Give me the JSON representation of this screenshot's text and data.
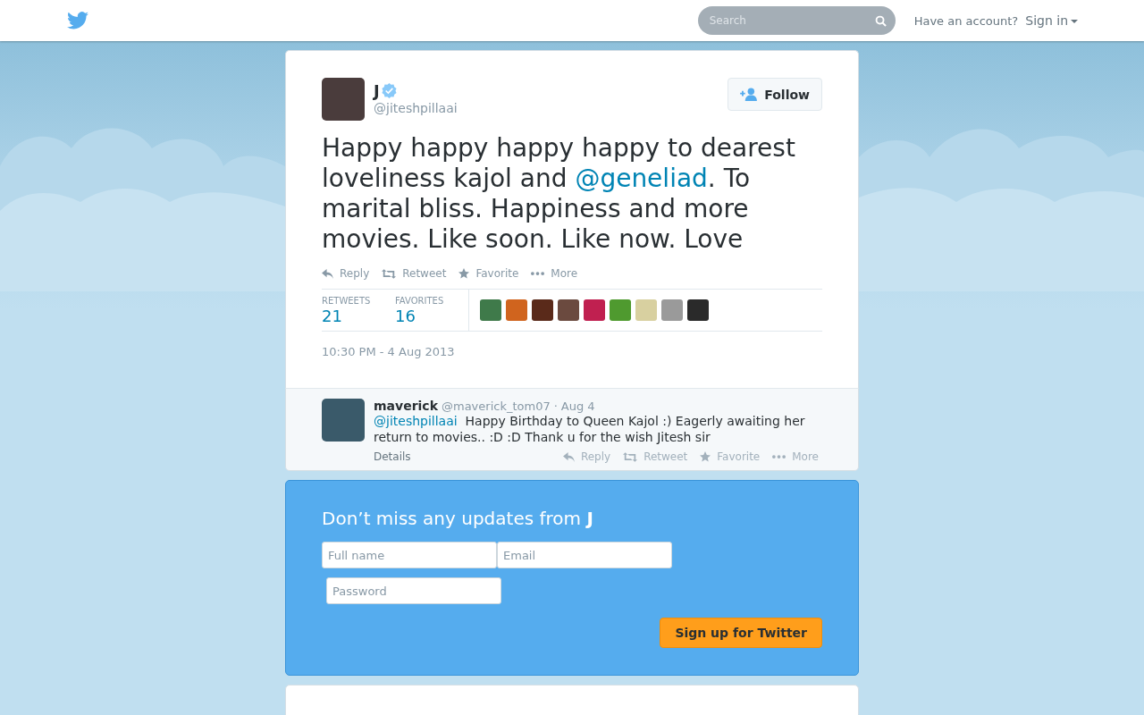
{
  "topbar": {
    "search": {
      "placeholder": "Search"
    },
    "account_prompt": "Have an account?",
    "sign_in": "Sign in"
  },
  "tweet": {
    "name": "J",
    "verified": true,
    "handle": "@jiteshpillaai",
    "follow": "Follow",
    "text_parts": [
      {
        "kind": "text",
        "text": "Happy happy happy happy to dearest loveliness kajol and "
      },
      {
        "kind": "link",
        "text": "@geneliad"
      },
      {
        "kind": "text",
        "text": ". To marital bliss. Happiness and more movies. Like soon. Like now. Love"
      }
    ],
    "actions": [
      {
        "kind": "reply",
        "label": "Reply"
      },
      {
        "kind": "retweet",
        "label": "Retweet"
      },
      {
        "kind": "favorite",
        "label": "Favorite"
      },
      {
        "kind": "more",
        "label": "More"
      }
    ],
    "stats": [
      {
        "label": "RETWEETS",
        "value": "21"
      },
      {
        "label": "FAVORITES",
        "value": "16"
      }
    ],
    "timestamp": "10:30 PM - 4 Aug 2013"
  },
  "reply": {
    "name": "maverick",
    "handle": "@maverick_tom07",
    "separator": "·",
    "date": "Aug 4",
    "mention": "@jiteshpillaai",
    "text": "Happy Birthday to Queen Kajol :) Eagerly awaiting her return to movies.. :D :D Thank u for the wish Jitesh sir",
    "details": "Details",
    "actions": [
      {
        "kind": "reply",
        "label": "Reply"
      },
      {
        "kind": "retweet",
        "label": "Retweet"
      },
      {
        "kind": "favorite",
        "label": "Favorite"
      },
      {
        "kind": "more",
        "label": "More"
      }
    ]
  },
  "signup": {
    "title_prefix": "Don’t miss any updates from",
    "title_name": "J",
    "fields": [
      {
        "placeholder": "Full name"
      },
      {
        "placeholder": "Email"
      },
      {
        "placeholder": "Password"
      }
    ],
    "button": "Sign up for Twitter"
  }
}
